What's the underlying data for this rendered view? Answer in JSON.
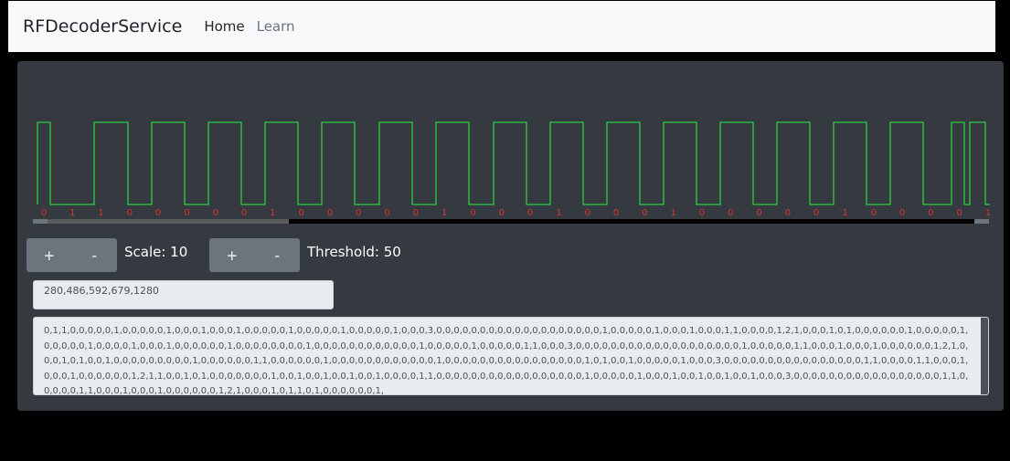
{
  "navbar": {
    "brand": "RFDecoderService",
    "links": [
      {
        "label": "Home"
      },
      {
        "label": "Learn"
      }
    ]
  },
  "signal": {
    "color": "#2ecc40",
    "bit_label_color": "#d9332e",
    "bits": [
      "0",
      "1",
      "1",
      "0",
      "0",
      "0",
      "0",
      "0",
      "1",
      "0",
      "0",
      "0",
      "0",
      "0",
      "1",
      "0",
      "0",
      "0",
      "1",
      "0",
      "0",
      "0",
      "1",
      "0",
      "0",
      "0",
      "0",
      "0",
      "1",
      "0",
      "0",
      "0",
      "0",
      "1"
    ]
  },
  "scale": {
    "plus": "+",
    "minus": "-",
    "label": "Scale: 10"
  },
  "threshold": {
    "plus": "+",
    "minus": "-",
    "label": "Threshold: 50"
  },
  "pulse_input": {
    "value": "280,486,592,679,1280"
  },
  "raw_data": "0,1,1,0,0,0,0,0,1,0,0,0,0,0,1,0,0,0,1,0,0,0,1,0,0,0,0,0,1,0,0,0,0,0,1,0,0,0,0,0,1,0,0,0,3,0,0,0,0,0,0,0,0,0,0,0,0,0,0,0,0,0,0,0,1,0,0,0,0,0,1,0,0,0,1,0,0,0,1,1,0,0,0,0,1,2,1,0,0,0,1,0,1,0,0,0,0,0,0,1,0,0,0,0,0,1,0,0,0,0,0,1,0,0,0,0,1,0,0,0,1,0,0,0,0,0,0,1,0,0,0,0,0,0,0,0,1,0,0,0,0,0,0,0,0,0,0,0,0,1,0,0,0,0,0,1,0,0,0,0,0,1,1,0,0,0,3,0,0,0,0,0,0,0,0,0,0,0,0,0,0,0,0,0,0,0,1,0,0,0,0,0,1,1,0,0,0,1,0,0,0,1,0,0,0,0,0,0,1,2,1,0,0,0,1,0,1,0,0,1,0,0,0,0,0,0,0,0,0,1,0,0,0,0,0,0,1,1,0,0,0,0,0,0,1,0,0,0,0,0,0,0,0,0,0,0,0,1,0,0,0,0,0,0,0,0,0,0,0,0,0,0,0,0,1,0,1,0,0,1,0,0,0,0,0,1,0,0,0,3,0,0,0,0,0,0,0,0,0,0,0,0,0,0,0,0,1,1,0,0,0,0,1,1,0,0,0,1,0,0,0,1,0,0,0,0,0,0,1,2,1,1,0,0,1,0,1,0,0,0,0,0,0,0,1,0,0,1,0,0,1,0,0,1,0,0,1,0,0,0,0,1,1,0,0,0,0,0,0,0,0,0,0,0,0,0,0,0,0,0,1,0,0,0,0,0,1,0,0,0,1,0,0,1,0,0,1,0,0,1,0,0,0,3,0,0,0,0,0,0,0,0,0,0,0,0,0,0,0,0,0,1,1,0,0,0,0,0,1,1,0,0,0,1,0,0,0,1,0,0,0,0,0,0,1,2,1,0,0,0,1,0,1,1,0,1,0,0,0,0,0,0,1,"
}
